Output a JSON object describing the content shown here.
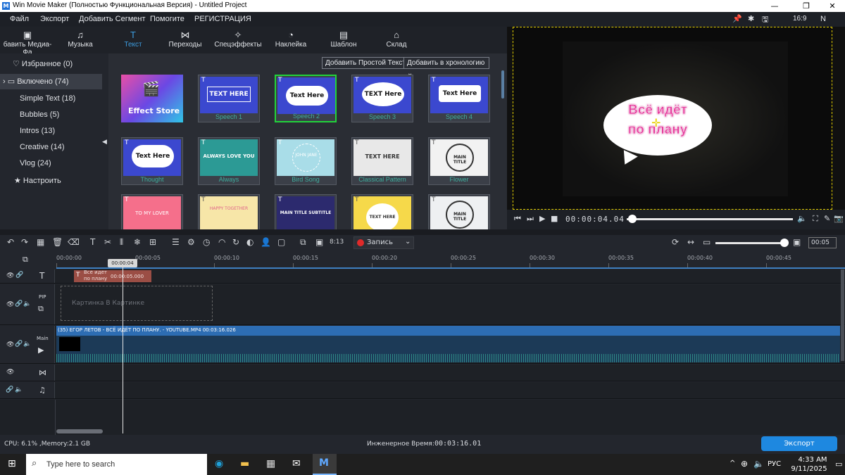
{
  "window": {
    "title": "Win Movie Maker (Полностью Функциональная Версия) - Untitled Project",
    "logo": "M"
  },
  "menu": [
    "Файл",
    "Экспорт",
    "Добавить Сегмент",
    "Помогите",
    "РЕГИСТРАЦИЯ"
  ],
  "right_icons": {
    "ratio": "16:9",
    "lang": "N"
  },
  "tools": [
    {
      "label": "бавить Медиа-Фа",
      "icon": "folder-icon"
    },
    {
      "label": "Музыка",
      "icon": "music-icon"
    },
    {
      "label": "Текст",
      "icon": "text-icon"
    },
    {
      "label": "Переходы",
      "icon": "transition-icon"
    },
    {
      "label": "Спецэффекты",
      "icon": "effects-icon"
    },
    {
      "label": "Наклейка",
      "icon": "sticker-icon"
    },
    {
      "label": "Шаблон",
      "icon": "template-icon"
    },
    {
      "label": "Склад",
      "icon": "store-icon"
    }
  ],
  "sidebar": {
    "favorites": "Избранное (0)",
    "included": "Включено (74)",
    "items": [
      "Simple Text (18)",
      "Bubbles (5)",
      "Intros (13)",
      "Creative (14)",
      "Vlog (24)"
    ],
    "customize": "Настроить"
  },
  "gallery": {
    "add_simple_text": "Добавить Простой Текст",
    "add_to_timeline": "Добавить в хронологию",
    "cards": [
      {
        "caption": "",
        "thumb_text": "Effect Store"
      },
      {
        "caption": "Speech 1",
        "thumb_text": "TEXT HERE"
      },
      {
        "caption": "Speech 2",
        "thumb_text": "Text Here"
      },
      {
        "caption": "Speech 3",
        "thumb_text": "TEXT Here"
      },
      {
        "caption": "Speech 4",
        "thumb_text": "Text Here"
      },
      {
        "caption": "Thought",
        "thumb_text": "Text Here"
      },
      {
        "caption": "Always",
        "thumb_text": "ALWAYS LOVE YOU"
      },
      {
        "caption": "Bird Song",
        "thumb_text": "JOHN JANE"
      },
      {
        "caption": "Classical Pattern",
        "thumb_text": "TEXT HERE"
      },
      {
        "caption": "Flower",
        "thumb_text": "MAIN TITLE"
      },
      {
        "caption": "",
        "thumb_text": "TO MY LOVER"
      },
      {
        "caption": "",
        "thumb_text": "HAPPY TOGETHER"
      },
      {
        "caption": "",
        "thumb_text": "MAIN TITLE SUBTITLE"
      },
      {
        "caption": "",
        "thumb_text": "TEXT HERE"
      },
      {
        "caption": "",
        "thumb_text": "MAIN TITLE"
      }
    ]
  },
  "preview": {
    "caption_line1": "Всё идёт",
    "caption_line2": "по плану",
    "timecode": "00:00:04.04"
  },
  "timeline": {
    "record_label": "Запись",
    "fps": "8:13",
    "zoom_value": "00:05",
    "ruler": [
      "00:00:00",
      "00:00:05",
      "00:00:10",
      "00:00:15",
      "00:00:20",
      "00:00:25",
      "00:00:30",
      "00:00:35",
      "00:00:40",
      "00:00:45"
    ],
    "playhead": "00:00:04",
    "text_clip_title": "Всё идёт по плану",
    "text_clip_time": "00:00:05.000",
    "pip_label": "PIP",
    "pip_placeholder": "Картинка В Картинке",
    "main_label": "Main",
    "main_clip": "(35) ЕГОР ЛЕТОВ - ВСЁ ИДЁТ ПО ПЛАНУ. - YOUTUBE.MP4   00:03:16.026"
  },
  "status": {
    "cpu": "CPU: 6.1% ,Memory:2.1 GB",
    "eng_time_label": "Инженерное Время:",
    "eng_time": "00:03:16.01",
    "export": "Экспорт"
  },
  "taskbar": {
    "search": "Type here to search",
    "lang": "РУС",
    "time": "4:33 AM",
    "date": "9/11/2025"
  }
}
